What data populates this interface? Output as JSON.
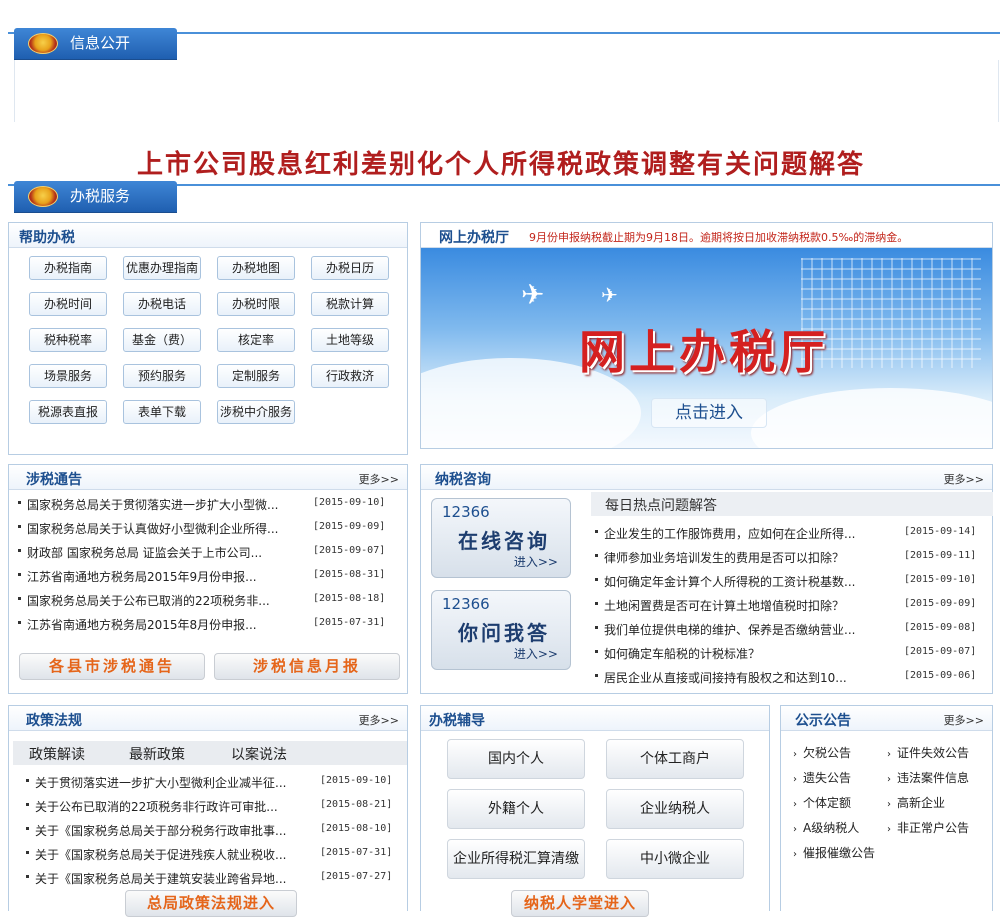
{
  "sections": {
    "info_label": "信息公开",
    "service_label": "办税服务"
  },
  "headline": "上市公司股息红利差别化个人所得税政策调整有关问题解答",
  "help": {
    "title": "帮助办税",
    "buttons": [
      "办税指南",
      "优惠办理指南",
      "办税地图",
      "办税日历",
      "办税时间",
      "办税电话",
      "办税时限",
      "税款计算",
      "税种税率",
      "基金（费）",
      "核定率",
      "土地等级",
      "场景服务",
      "预约服务",
      "定制服务",
      "行政救济",
      "税源表直报",
      "表单下载",
      "涉税中介服务"
    ]
  },
  "online": {
    "title": "网上办税厅",
    "notice": "9月份申报纳税截止期为9月18日。逾期将按日加收滞纳税款0.5‰的滞纳金。",
    "banner_title": "网上办税厅",
    "enter": "点击进入"
  },
  "notices": {
    "title": "涉税通告",
    "more": "更多>>",
    "items": [
      {
        "t": "国家税务总局关于贯彻落实进一步扩大小型微...",
        "d": "[2015-09-10]"
      },
      {
        "t": "国家税务总局关于认真做好小型微利企业所得...",
        "d": "[2015-09-09]"
      },
      {
        "t": "财政部 国家税务总局 证监会关于上市公司...",
        "d": "[2015-09-07]"
      },
      {
        "t": "江苏省南通地方税务局2015年9月份申报...",
        "d": "[2015-08-31]"
      },
      {
        "t": "国家税务总局关于公布已取消的22项税务非...",
        "d": "[2015-08-18]"
      },
      {
        "t": "江苏省南通地方税务局2015年8月份申报...",
        "d": "[2015-07-31]"
      }
    ],
    "btn_left": "各县市涉税通告",
    "btn_right": "涉税信息月报"
  },
  "consult": {
    "title": "纳税咨询",
    "more": "更多>>",
    "box1": {
      "num": "12366",
      "main": "在线咨询",
      "go": "进入>>"
    },
    "box2": {
      "num": "12366",
      "main": "你问我答",
      "go": "进入>>"
    },
    "hot_title": "每日热点问题解答",
    "items": [
      {
        "t": "企业发生的工作服饰费用，应如何在企业所得...",
        "d": "[2015-09-14]"
      },
      {
        "t": "律师参加业务培训发生的费用是否可以扣除？",
        "d": "[2015-09-11]"
      },
      {
        "t": "如何确定年金计算个人所得税的工资计税基数...",
        "d": "[2015-09-10]"
      },
      {
        "t": "土地闲置费是否可在计算土地增值税时扣除？",
        "d": "[2015-09-09]"
      },
      {
        "t": "我们单位提供电梯的维护、保养是否缴纳营业...",
        "d": "[2015-09-08]"
      },
      {
        "t": "如何确定车船税的计税标准？",
        "d": "[2015-09-07]"
      },
      {
        "t": "居民企业从直接或间接持有股权之和达到10...",
        "d": "[2015-09-06]"
      }
    ]
  },
  "policy": {
    "title": "政策法规",
    "more": "更多>>",
    "tabs": [
      "政策解读",
      "最新政策",
      "以案说法"
    ],
    "items": [
      {
        "t": "关于贯彻落实进一步扩大小型微利企业减半征...",
        "d": "[2015-09-10]"
      },
      {
        "t": "关于公布已取消的22项税务非行政许可审批...",
        "d": "[2015-08-21]"
      },
      {
        "t": "关于《国家税务总局关于部分税务行政审批事...",
        "d": "[2015-08-10]"
      },
      {
        "t": "关于《国家税务总局关于促进残疾人就业税收...",
        "d": "[2015-07-31]"
      },
      {
        "t": "关于《国家税务总局关于建筑安装业跨省异地...",
        "d": "[2015-07-27]"
      }
    ],
    "bottom_btn": "总局政策法规进入"
  },
  "guide": {
    "title": "办税辅导",
    "buttons": [
      "国内个人",
      "个体工商户",
      "外籍个人",
      "企业纳税人",
      "企业所得税汇算清缴",
      "中小微企业"
    ],
    "bottom_btn": "纳税人学堂进入"
  },
  "public": {
    "title": "公示公告",
    "more": "更多>>",
    "items": [
      "欠税公告",
      "证件失效公告",
      "遗失公告",
      "违法案件信息",
      "个体定额",
      "高新企业",
      "A级纳税人",
      "非正常户公告",
      "催报催缴公告"
    ]
  }
}
